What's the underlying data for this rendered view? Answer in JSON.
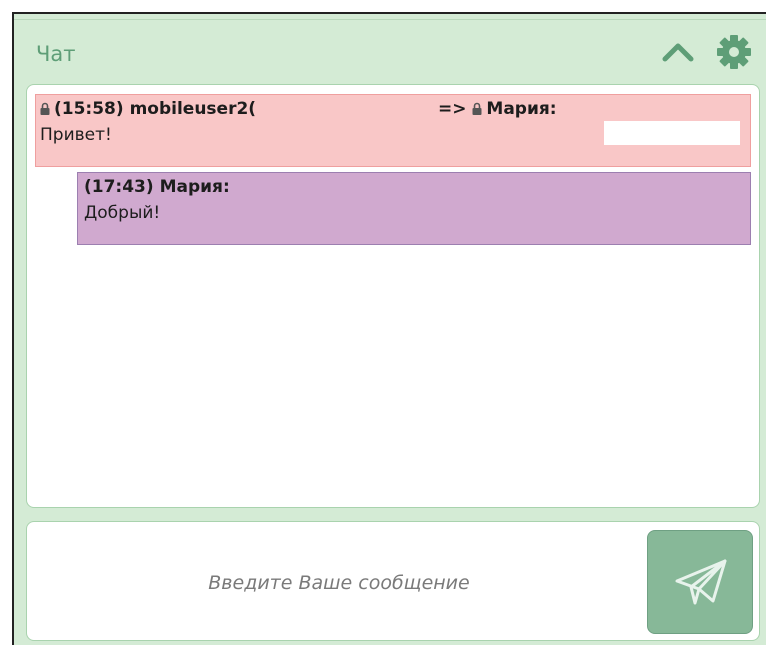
{
  "header": {
    "title": "Чат",
    "collapse_icon": "chevron-up-icon",
    "settings_icon": "gear-icon",
    "accent_color": "#5e9e77"
  },
  "messages": [
    {
      "time": "(15:58)",
      "sender": "mobileuser2(",
      "arrow": "=>",
      "recipient": "Мария:",
      "text": "Привет!",
      "private": true,
      "color": "#f9c7c7"
    },
    {
      "time": "(17:43)",
      "sender": "Мария:",
      "text": "Добрый!",
      "private": false,
      "color": "#d0a9cf"
    }
  ],
  "composer": {
    "placeholder": "Введите Ваше сообщение",
    "value": "",
    "send_icon": "paper-plane-icon"
  }
}
